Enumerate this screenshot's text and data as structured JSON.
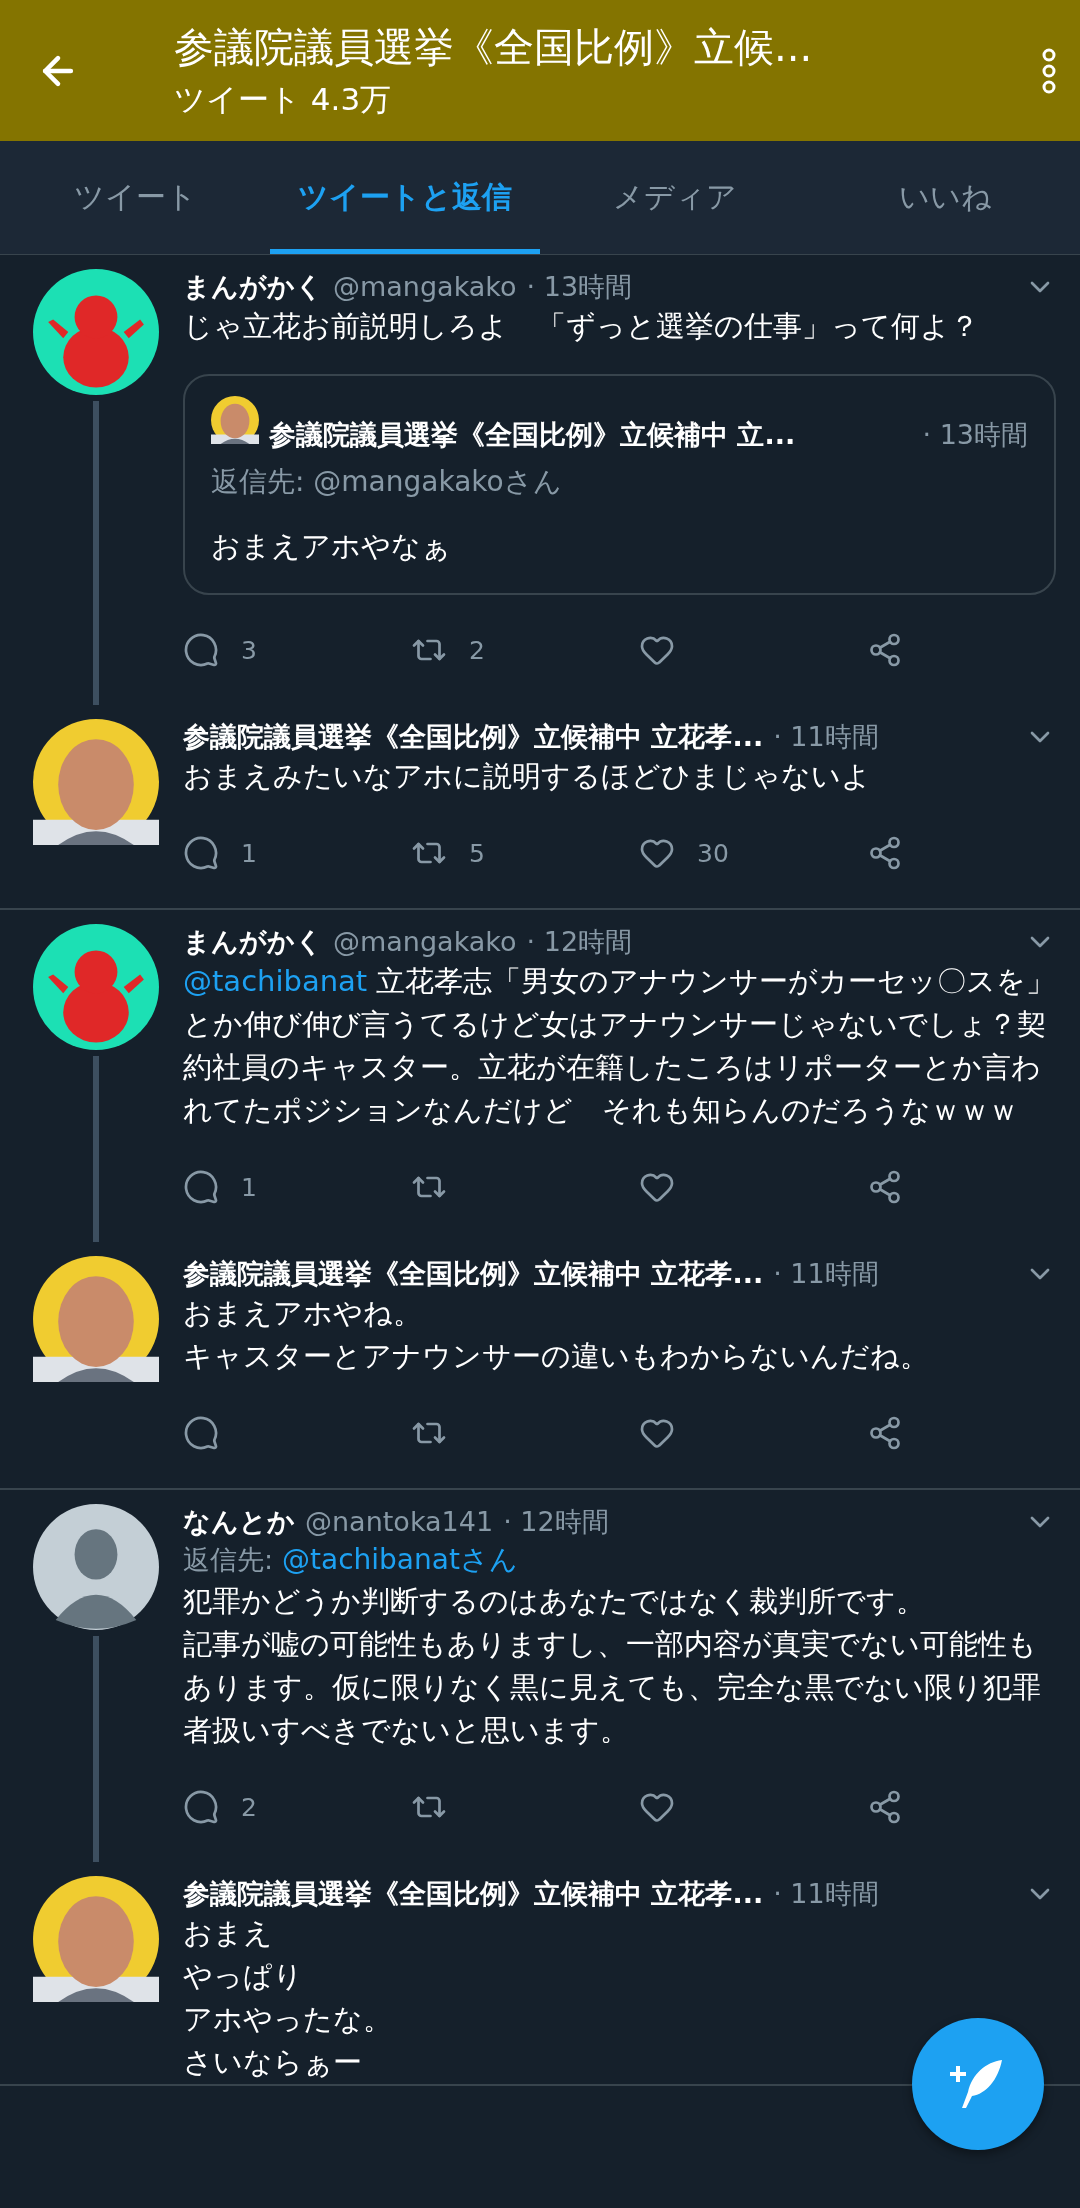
{
  "header": {
    "title": "参議院議員選挙《全国比例》立候...",
    "subtitle": "ツイート 4.3万"
  },
  "tabs": [
    {
      "label": "ツイート",
      "selected": false
    },
    {
      "label": "ツイートと返信",
      "selected": true
    },
    {
      "label": "メディア",
      "selected": false
    },
    {
      "label": "いいね",
      "selected": false
    }
  ],
  "threads": [
    {
      "tweets": [
        {
          "avatar": {
            "kind": "character"
          },
          "name": "まんがかく",
          "handle": "@mangakako",
          "time": "· 13時間",
          "lines": [
            [
              {
                "kind": "plain",
                "text": "じゃ立花お前説明しろよ　「ずっと選挙の仕事」って何よ？"
              }
            ]
          ],
          "quote": {
            "name": "参議院議員選挙《全国比例》立候補中 立...",
            "time": "· 13時間",
            "reply_line": "返信先: @mangakakoさん",
            "text": "おまえアホやなぁ"
          },
          "actions": [
            {
              "kind": "reply",
              "count": "3"
            },
            {
              "kind": "retweet",
              "count": "2"
            },
            {
              "kind": "like"
            },
            {
              "kind": "share"
            }
          ],
          "connector_below": true
        },
        {
          "avatar": {
            "kind": "photo"
          },
          "name": "参議院議員選挙《全国比例》立候補中 立花孝...",
          "time": "· 11時間",
          "lines": [
            [
              {
                "kind": "plain",
                "text": "おまえみたいなアホに説明するほどひまじゃないよ"
              }
            ]
          ],
          "actions": [
            {
              "kind": "reply",
              "count": "1"
            },
            {
              "kind": "retweet",
              "count": "5"
            },
            {
              "kind": "like",
              "count": "30"
            },
            {
              "kind": "share"
            }
          ],
          "connector_below": false
        }
      ]
    },
    {
      "tweets": [
        {
          "avatar": {
            "kind": "character"
          },
          "name": "まんがかく",
          "handle": "@mangakako",
          "time": "· 12時間",
          "lines": [
            [
              {
                "kind": "mention",
                "text": "@tachibanat"
              },
              {
                "kind": "plain",
                "text": " 立花孝志「男女のアナウンサーがカーセッ〇スを」とか伸び伸び言うてるけど女はアナウンサーじゃないでしょ？契約社員のキャスター。立花が在籍したころはリポーターとか言われてたポジションなんだけど　それも知らんのだろうなｗｗｗ"
              }
            ]
          ],
          "actions": [
            {
              "kind": "reply",
              "count": "1"
            },
            {
              "kind": "retweet"
            },
            {
              "kind": "like"
            },
            {
              "kind": "share"
            }
          ],
          "connector_below": true
        },
        {
          "avatar": {
            "kind": "photo"
          },
          "name": "参議院議員選挙《全国比例》立候補中 立花孝...",
          "time": "· 11時間",
          "lines": [
            [
              {
                "kind": "plain",
                "text": "おまえアホやね。"
              }
            ],
            [
              {
                "kind": "plain",
                "text": "キャスターとアナウンサーの違いもわからないんだね。"
              }
            ]
          ],
          "actions": [
            {
              "kind": "reply"
            },
            {
              "kind": "retweet"
            },
            {
              "kind": "like"
            },
            {
              "kind": "share"
            }
          ],
          "connector_below": false
        }
      ]
    },
    {
      "tweets": [
        {
          "avatar": {
            "kind": "default"
          },
          "name": "なんとか",
          "handle": "@nantoka141",
          "time": "· 12時間",
          "reply_label": "返信先:",
          "reply_to": "@tachibanatさん",
          "lines": [
            [
              {
                "kind": "plain",
                "text": "犯罪かどうか判断するのはあなたではなく裁判所です。"
              }
            ],
            [
              {
                "kind": "plain",
                "text": "記事が嘘の可能性もありますし、一部内容が真実でない可能性もあります。仮に限りなく黒に見えても、完全な黒でない限り犯罪者扱いすべきでないと思います。"
              }
            ]
          ],
          "actions": [
            {
              "kind": "reply",
              "count": "2"
            },
            {
              "kind": "retweet"
            },
            {
              "kind": "like"
            },
            {
              "kind": "share"
            }
          ],
          "connector_below": true
        },
        {
          "avatar": {
            "kind": "photo"
          },
          "name": "参議院議員選挙《全国比例》立候補中 立花孝...",
          "time": "· 11時間",
          "lines": [
            [
              {
                "kind": "plain",
                "text": "おまえ"
              }
            ],
            [
              {
                "kind": "plain",
                "text": "やっぱり"
              }
            ],
            [
              {
                "kind": "plain",
                "text": "アホやったな。"
              }
            ],
            [
              {
                "kind": "plain",
                "text": "さいならぁー"
              }
            ]
          ],
          "connector_below": false
        }
      ]
    }
  ]
}
